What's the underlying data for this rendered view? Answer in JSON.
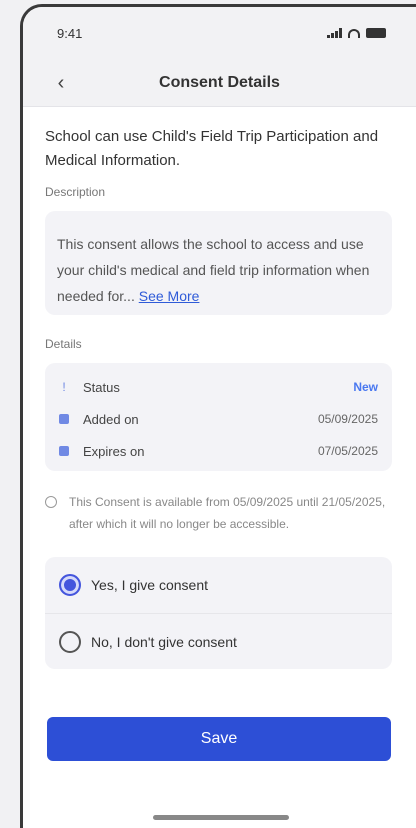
{
  "status_bar": {
    "time": "9:41"
  },
  "nav": {
    "back_icon": "chevron-left-icon",
    "title": "Consent Details"
  },
  "intro": "School can use Child's Field Trip Participation and Medical Information.",
  "description": {
    "label": "Description",
    "text": "This consent allows the school to access and use your child's medical and field trip information when needed for... ",
    "see_more": "See More"
  },
  "details": {
    "label": "Details",
    "rows": [
      {
        "icon": "status-icon",
        "label": "Status",
        "value": "New"
      },
      {
        "icon": "calendar-icon",
        "label": "Added on",
        "value": "05/09/2025"
      },
      {
        "icon": "calendar-icon",
        "label": "Expires on",
        "value": "07/05/2025"
      }
    ]
  },
  "note": "This Consent is available from 05/09/2025 until 21/05/2025, after which it will no longer be accessible.",
  "options": [
    {
      "label": "Yes, I give consent",
      "selected": true
    },
    {
      "label": "No, I don't give consent",
      "selected": false
    }
  ],
  "save_label": "Save",
  "colors": {
    "accent": "#2d4fd6",
    "link": "#2f5bd8",
    "status_new": "#4a78f0"
  }
}
